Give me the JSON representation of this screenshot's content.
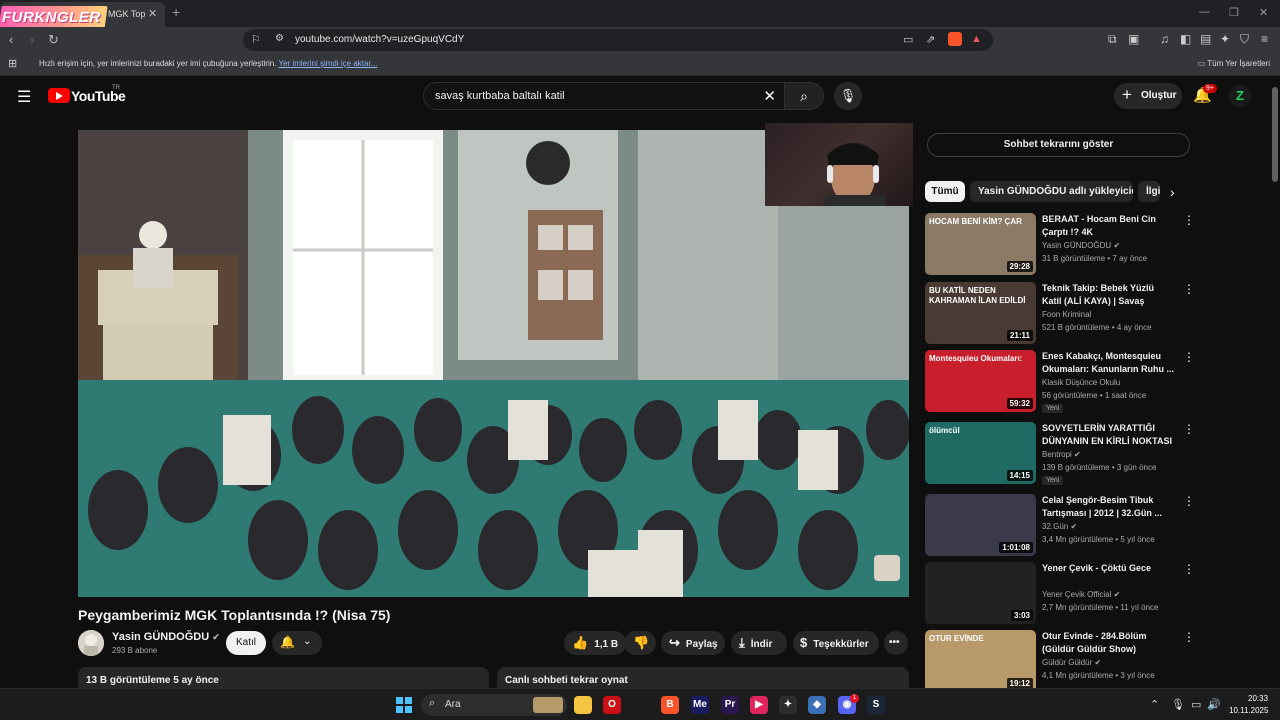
{
  "browser": {
    "overlay_logo": "FURKNGLER",
    "tab_title": "MGK Top",
    "tab_close": "✕",
    "new_tab": "+",
    "url": "youtube.com/watch?v=uzeGpuqVCdY",
    "bookmarks_hint": "Hızlı erişim için, yer imlerinizi buradaki yer imi çubuğuna yerleştirin.",
    "bookmarks_import_link": "Yer imlerini şimdi içe aktar...",
    "all_bookmarks": "Tüm Yer İşaretleri"
  },
  "youtube": {
    "wordmark": "YouTube",
    "tr": "TR",
    "search_query": "savaş kurtbaba baltalı katil",
    "create_label": "Oluştur",
    "notif_badge": "9+",
    "avatar_letter": "Z"
  },
  "video": {
    "title": "Peygamberimiz MGK Toplantısında !? (Nisa 75)",
    "channel": "Yasin GÜNDOĞDU",
    "subscribers": "293 B abone",
    "join_label": "Katıl",
    "likes": "1,1 B",
    "share_label": "Paylaş",
    "download_label": "İndir",
    "thanks_label": "Teşekkürler",
    "more": "•••",
    "views_date": "13 B görüntüleme  5 ay önce",
    "chat_replay_label": "Canlı sohbeti tekrar oynat"
  },
  "sidebar": {
    "show_chat_replay": "Sohbet tekrarını göster",
    "chips": [
      "Tümü",
      "Yasin GÜNDOĞDU adlı yükleyiciden",
      "İlgili"
    ],
    "recommendations": [
      {
        "title": "BERAAT - Hocam Beni Cin Çarptı !? 4K",
        "channel": "Yasin GÜNDOĞDU",
        "verified": true,
        "meta": "31 B görüntüleme • 7 ay önce",
        "duration": "29:28",
        "badge": "",
        "thumb_caption": "HOCAM BENİ KİM? ÇAR",
        "color": "#8a7a66"
      },
      {
        "title": "Teknik Takip: Bebek Yüzlü Katil (ALİ KAYA) | Savaş Kurtbaba ...",
        "channel": "Foon Kriminal",
        "verified": false,
        "meta": "521 B görüntüleme • 4 ay önce",
        "duration": "21:11",
        "badge": "",
        "thumb_caption": "BU KATİL NEDEN KAHRAMAN İLAN EDİLDİ",
        "color": "#4a3a34"
      },
      {
        "title": "Enes Kabakçı, Montesquieu Okumaları: Kanunların Ruhu ...",
        "channel": "Klasik Düşünce Okulu",
        "verified": false,
        "meta": "56 görüntüleme • 1 saat önce",
        "duration": "59:32",
        "badge": "Yeni",
        "thumb_caption": "Montesquieu Okumaları:",
        "color": "#c91f2c"
      },
      {
        "title": "SOVYETLERİN YARATTIĞI DÜNYANIN EN KİRLİ NOKTASI",
        "channel": "Bentropi",
        "verified": true,
        "meta": "139 B görüntüleme • 3 gün önce",
        "duration": "14:15",
        "badge": "Yeni",
        "thumb_caption": "ölümcül",
        "color": "#1f6b63"
      },
      {
        "title": "Celal Şengör-Besim Tibuk Tartışması | 2012 | 32.Gün ...",
        "channel": "32.Gün",
        "verified": true,
        "meta": "3,4 Mn görüntüleme • 5 yıl önce",
        "duration": "1:01:08",
        "badge": "",
        "thumb_caption": "",
        "color": "#3a3a4a"
      },
      {
        "title": "Yener Çevik - Çöktü Gece",
        "channel": "Yener Çevik Official",
        "verified": true,
        "meta": "2,7 Mn görüntüleme • 11 yıl önce",
        "duration": "3:03",
        "badge": "",
        "thumb_caption": "",
        "color": "#222222"
      },
      {
        "title": "Otur Evinde - 284.Bölüm (Güldür Güldür Show)",
        "channel": "Güldür Güldür",
        "verified": true,
        "meta": "4,1 Mn görüntüleme • 3 yıl önce",
        "duration": "19:12",
        "badge": "",
        "thumb_caption": "OTUR EVİNDE",
        "color": "#b89a6a"
      }
    ]
  },
  "taskbar": {
    "search_label": "Ara",
    "time": "20:33",
    "date": "10.11.2025",
    "apps": [
      {
        "name": "file-explorer-icon",
        "label": "",
        "color": "#f4c542"
      },
      {
        "name": "opera-icon",
        "label": "O",
        "color": "#cc0f16"
      },
      {
        "name": "brave-icon",
        "label": "B",
        "color": "#fb542b"
      },
      {
        "name": "media-encoder-icon",
        "label": "Me",
        "color": "#1a1a5e"
      },
      {
        "name": "premiere-icon",
        "label": "Pr",
        "color": "#2a1750"
      },
      {
        "name": "media-player-icon",
        "label": "▶",
        "color": "#e0245e"
      },
      {
        "name": "chatgpt-icon",
        "label": "✦",
        "color": "#2d2d2d"
      },
      {
        "name": "app-icon",
        "label": "◆",
        "color": "#3b6fb6"
      },
      {
        "name": "discord-icon",
        "label": "◉",
        "color": "#5865f2"
      },
      {
        "name": "steam-icon",
        "label": "S",
        "color": "#1b2838"
      }
    ],
    "discord_badge": "1"
  }
}
